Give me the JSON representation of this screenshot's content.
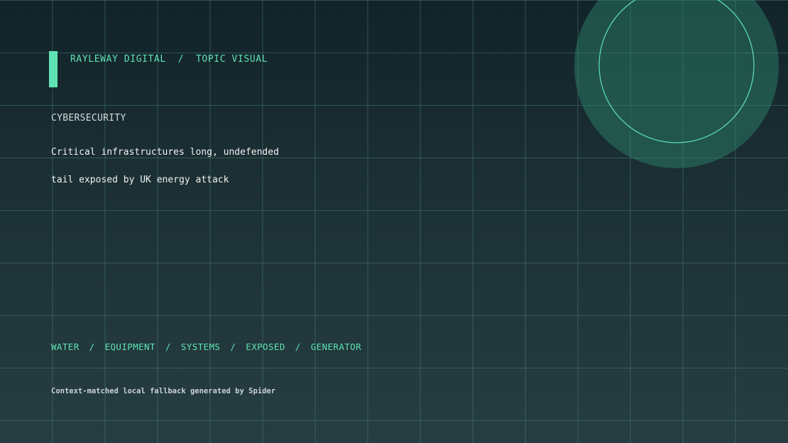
{
  "brand": {
    "name": "RAYLEWAY DIGITAL",
    "separator": "/",
    "section": "TOPIC VISUAL"
  },
  "category": "CYBERSECURITY",
  "headline": {
    "line1": "Critical infrastructures long, undefended",
    "line2": "tail exposed by UK energy attack"
  },
  "tags": {
    "separator": "/",
    "items": [
      "WATER",
      "EQUIPMENT",
      "SYSTEMS",
      "EXPOSED",
      "GENERATOR"
    ]
  },
  "footer": "Context-matched local fallback generated by Spider",
  "colors": {
    "accent": "#5fe3b3",
    "grid": "#4f8a86",
    "circle_fill": "#24564c"
  }
}
